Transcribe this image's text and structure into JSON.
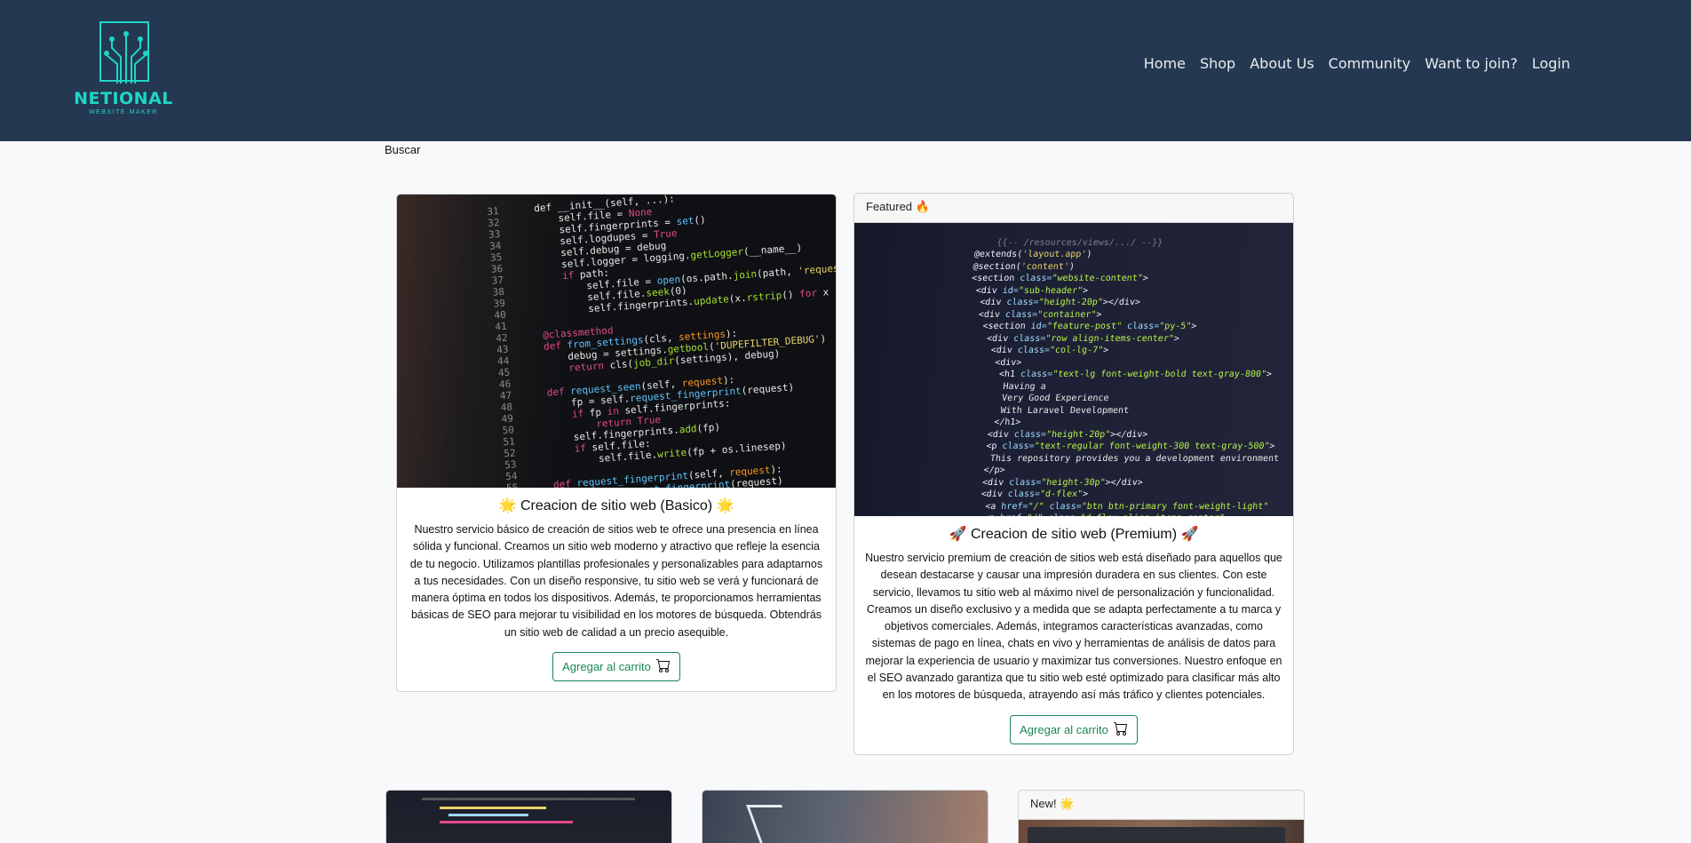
{
  "brand": {
    "name": "NETIONAL",
    "tagline": "WEBSITE MAKER"
  },
  "nav": {
    "links": [
      "Home",
      "Shop",
      "About Us",
      "Community",
      "Want to join?",
      "Login"
    ]
  },
  "search": {
    "label": "Buscar"
  },
  "cards": [
    {
      "header": "",
      "title": "🌟 Creacion de sitio web (Basico) 🌟",
      "text": "Nuestro servicio básico de creación de sitios web te ofrece una presencia en línea sólida y funcional. Creamos un sitio web moderno y atractivo que refleje la esencia de tu negocio. Utilizamos plantillas profesionales y personalizables para adaptarnos a tus necesidades. Con un diseño responsive, tu sitio web se verá y funcionará de manera óptima en todos los dispositivos. Además, te proporcionamos herramientas básicas de SEO para mejorar tu visibilidad en los motores de búsqueda. Obtendrás un sitio web de calidad a un precio asequible.",
      "button": "Agregar al carrito"
    },
    {
      "header": "Featured 🔥",
      "title": "🚀 Creacion de sitio web (Premium) 🚀",
      "text": "Nuestro servicio premium de creación de sitios web está diseñado para aquellos que desean destacarse y causar una impresión duradera en sus clientes. Con este servicio, llevamos tu sitio web al máximo nivel de personalización y funcionalidad. Creamos un diseño exclusivo y a medida que se adapta perfectamente a tu marca y objetivos comerciales. Además, integramos características avanzadas, como sistemas de pago en línea, chats en vivo y herramientas de análisis de datos para mejorar la experiencia de usuario y maximizar tus conversiones. Nuestro enfoque en el SEO avanzado garantiza que tu sitio web esté optimizado para clasificar más alto en los motores de búsqueda, atrayendo así más tráfico y clientes potenciales.",
      "button": "Agregar al carrito"
    }
  ],
  "bottom_cards": [
    {
      "header": ""
    },
    {
      "header": ""
    },
    {
      "header": "New! 🌟"
    }
  ],
  "colors": {
    "navbar": "#243851",
    "brand": "#1ed6c8",
    "button": "#198754"
  },
  "icons": {
    "cart": "cart-icon",
    "logo": "circuit-logo-icon"
  }
}
